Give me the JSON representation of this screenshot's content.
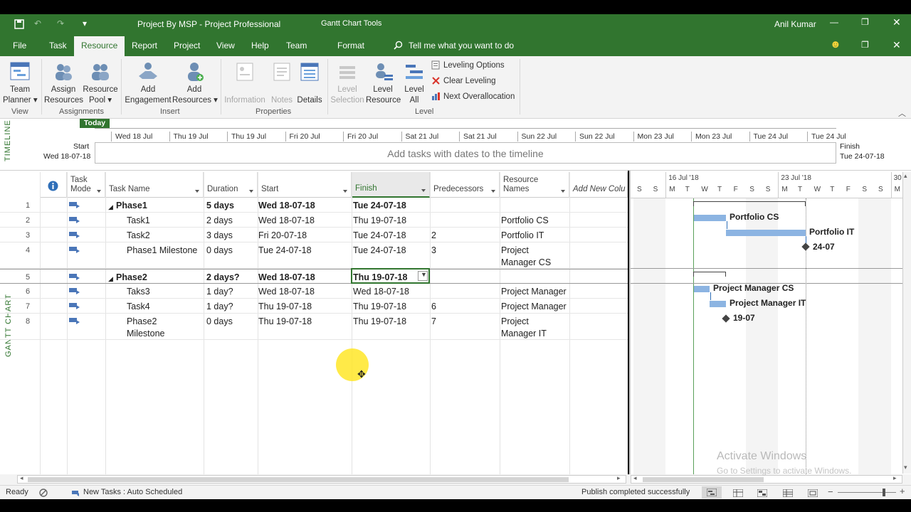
{
  "titlebar": {
    "title": "Project By MSP  -  Project Professional",
    "context_tools": "Gantt Chart Tools",
    "user": "Anil Kumar",
    "quick_access_more": "▾"
  },
  "menu": {
    "file": "File",
    "task": "Task",
    "resource": "Resource",
    "report": "Report",
    "project": "Project",
    "view": "View",
    "help": "Help",
    "team": "Team",
    "format": "Format",
    "tell_me": "Tell me what you want to do"
  },
  "ribbon": {
    "team_planner": [
      "Team",
      "Planner ▾"
    ],
    "assign_resources": [
      "Assign",
      "Resources"
    ],
    "resource_pool": [
      "Resource",
      "Pool ▾"
    ],
    "add_engagement": [
      "Add",
      "Engagement"
    ],
    "add_resources": [
      "Add",
      "Resources ▾"
    ],
    "information": "Information",
    "notes": "Notes",
    "details": "Details",
    "level_selection": [
      "Level",
      "Selection"
    ],
    "level_resource": [
      "Level",
      "Resource"
    ],
    "level_all": [
      "Level",
      "All"
    ],
    "leveling_options": "Leveling Options",
    "clear_leveling": "Clear Leveling",
    "next_overallocation": "Next Overallocation",
    "groups": {
      "view": "View",
      "assignments": "Assignments",
      "insert": "Insert",
      "properties": "Properties",
      "level": "Level"
    }
  },
  "timeline": {
    "label": "TIMELINE",
    "today": "Today",
    "start_label": "Start",
    "start_date": "Wed 18-07-18",
    "finish_label": "Finish",
    "finish_date": "Tue 24-07-18",
    "placeholder": "Add tasks with dates to the timeline",
    "days": [
      "Wed 18 Jul",
      "Thu 19 Jul",
      "Thu 19 Jul",
      "Fri 20 Jul",
      "Fri 20 Jul",
      "Sat 21 Jul",
      "Sat 21 Jul",
      "Sun 22 Jul",
      "Sun 22 Jul",
      "Mon 23 Jul",
      "Mon 23 Jul",
      "Tue 24 Jul",
      "Tue 24 Jul"
    ]
  },
  "grid": {
    "side_label": "GANTT CHART",
    "headers": {
      "mode": [
        "Task",
        "Mode"
      ],
      "name": "Task Name",
      "duration": "Duration",
      "start": "Start",
      "finish": "Finish",
      "predecessors": "Predecessors",
      "resources": [
        "Resource",
        "Names"
      ],
      "add_new": "Add New Colu"
    },
    "rows": [
      {
        "id": "1",
        "name": "Phase1",
        "duration": "5 days",
        "start": "Wed 18-07-18",
        "finish": "Tue 24-07-18",
        "pred": "",
        "res": ""
      },
      {
        "id": "2",
        "name": "Task1",
        "duration": "2 days",
        "start": "Wed 18-07-18",
        "finish": "Thu 19-07-18",
        "pred": "",
        "res": "Portfolio CS"
      },
      {
        "id": "3",
        "name": "Task2",
        "duration": "3 days",
        "start": "Fri 20-07-18",
        "finish": "Tue 24-07-18",
        "pred": "2",
        "res": "Portfolio IT"
      },
      {
        "id": "4",
        "name": "Phase1 Milestone",
        "duration": "0 days",
        "start": "Tue 24-07-18",
        "finish": "Tue 24-07-18",
        "pred": "3",
        "res": [
          "Project",
          "Manager CS"
        ]
      },
      {
        "id": "5",
        "name": "Phase2",
        "duration": "2 days?",
        "start": "Wed 18-07-18",
        "finish": "Thu 19-07-18",
        "pred": "",
        "res": ""
      },
      {
        "id": "6",
        "name": "Taks3",
        "duration": "1 day?",
        "start": "Wed 18-07-18",
        "finish": "Wed 18-07-18",
        "pred": "",
        "res": "Project Manager"
      },
      {
        "id": "7",
        "name": "Task4",
        "duration": "1 day?",
        "start": "Thu 19-07-18",
        "finish": "Thu 19-07-18",
        "pred": "6",
        "res": "Project Manager"
      },
      {
        "id": "8",
        "name": [
          "Phase2",
          "Milestone"
        ],
        "duration": "0 days",
        "start": "Thu 19-07-18",
        "finish": "Thu 19-07-18",
        "pred": "7",
        "res": [
          "Project",
          "Manager IT"
        ]
      }
    ]
  },
  "gantt": {
    "weeks": [
      "16 Jul '18",
      "23 Jul '18",
      "30 J"
    ],
    "days": [
      "S",
      "S",
      "M",
      "T",
      "W",
      "T",
      "F",
      "S",
      "S",
      "M",
      "T",
      "W",
      "T",
      "F",
      "S",
      "S",
      "M"
    ],
    "labels": {
      "task1": "Portfolio CS",
      "task2": "Portfolio IT",
      "m1": "24-07",
      "task3": "Project Manager CS",
      "task4": "Project Manager IT",
      "m2": "19-07"
    },
    "bar_color": "#8cb4e2"
  },
  "watermark": {
    "line1": "Activate Windows",
    "line2": "Go to Settings to activate Windows."
  },
  "status": {
    "ready": "Ready",
    "new_tasks": "New Tasks : Auto Scheduled",
    "publish": "Publish completed successfully"
  },
  "colors": {
    "accent": "#31752f",
    "bar": "#8cb4e2"
  }
}
